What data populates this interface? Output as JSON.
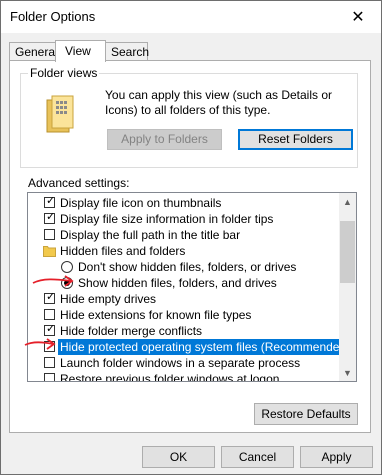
{
  "window": {
    "title": "Folder Options",
    "close_glyph": "✕"
  },
  "tabs": [
    {
      "label": "General"
    },
    {
      "label": "View"
    },
    {
      "label": "Search"
    }
  ],
  "folder_views": {
    "label": "Folder views",
    "description": "You can apply this view (such as Details or Icons) to all folders of this type.",
    "apply_label": "Apply to Folders",
    "reset_label": "Reset Folders",
    "icon": "folder-details-icon"
  },
  "advanced": {
    "label": "Advanced settings:",
    "items": [
      {
        "label": "Display file icon on thumbnails",
        "type": "checkbox",
        "checked": true
      },
      {
        "label": "Display file size information in folder tips",
        "type": "checkbox",
        "checked": true
      },
      {
        "label": "Display the full path in the title bar",
        "type": "checkbox",
        "checked": false
      },
      {
        "label": "Hidden files and folders",
        "type": "folder",
        "icon": "folder-icon"
      },
      {
        "label": "Don't show hidden files, folders, or drives",
        "type": "radio",
        "checked": false
      },
      {
        "label": "Show hidden files, folders, and drives",
        "type": "radio",
        "checked": true
      },
      {
        "label": "Hide empty drives",
        "type": "checkbox",
        "checked": true
      },
      {
        "label": "Hide extensions for known file types",
        "type": "checkbox",
        "checked": false
      },
      {
        "label": "Hide folder merge conflicts",
        "type": "checkbox",
        "checked": true
      },
      {
        "label": "Hide protected operating system files (Recommended)",
        "type": "checkbox",
        "checked": false,
        "selected": true
      },
      {
        "label": "Launch folder windows in a separate process",
        "type": "checkbox",
        "checked": false
      },
      {
        "label": "Restore previous folder windows at logon",
        "type": "checkbox",
        "checked": false
      }
    ]
  },
  "restore_defaults_label": "Restore Defaults",
  "footer": {
    "ok_label": "OK",
    "cancel_label": "Cancel",
    "apply_label": "Apply"
  },
  "colors": {
    "selection": "#0078d7",
    "annotation": "#e5202a"
  },
  "check_glyph": "✓"
}
